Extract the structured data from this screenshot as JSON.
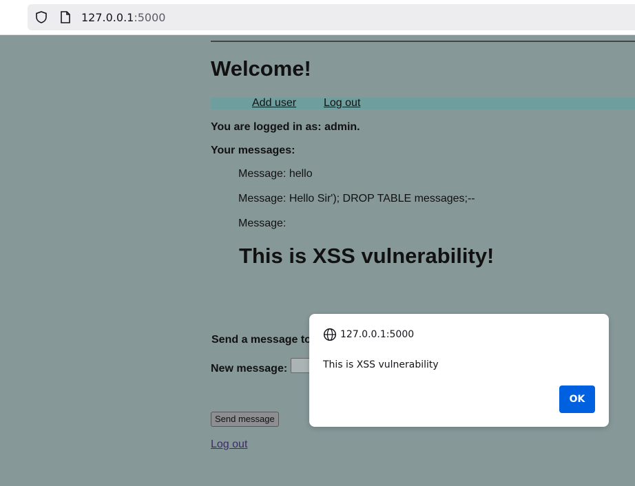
{
  "browser": {
    "url_host": "127.0.0.1",
    "url_port": ":5000"
  },
  "page": {
    "heading": "Welcome!",
    "nav": {
      "add_user": "Add user",
      "log_out": "Log out"
    },
    "logged_in_text": "You are logged in as: admin.",
    "messages_heading": "Your messages:",
    "messages": [
      "Message: hello",
      "Message: Hello Sir'); DROP TABLE messages;--",
      "Message:"
    ],
    "injected_heading": "This is XSS vulnerability!",
    "send_to_label": "Send a message to",
    "new_message_label": "New message:",
    "send_button": "Send message",
    "bottom_logout": "Log out"
  },
  "dialog": {
    "origin": "127.0.0.1:5000",
    "message": "This is XSS vulnerability",
    "ok_label": "OK"
  },
  "colors": {
    "page_background": "#879899",
    "nav_bar": "#6e9e9e",
    "ok_button": "#0061e0"
  }
}
